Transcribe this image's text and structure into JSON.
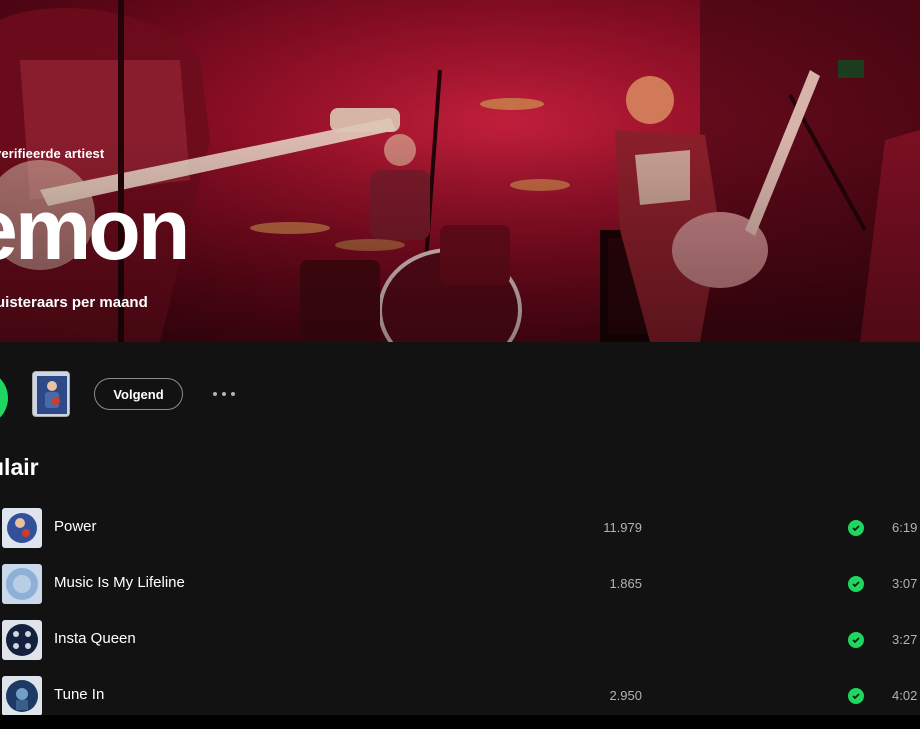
{
  "artist": {
    "verified_label": "verifieerde artiest",
    "name": "emon",
    "monthly_listeners": "uisteraars per maand"
  },
  "actions": {
    "follow_label": "Volgend",
    "more_icon": "more-horizontal-icon",
    "play_icon": "play-icon"
  },
  "popular": {
    "title": "ulair",
    "tracks": [
      {
        "title": "Power",
        "plays": "11.979",
        "duration": "6:19"
      },
      {
        "title": "Music Is My Lifeline",
        "plays": "1.865",
        "duration": "3:07"
      },
      {
        "title": "Insta Queen",
        "plays": "",
        "duration": "3:27"
      },
      {
        "title": "Tune In",
        "plays": "2.950",
        "duration": "4:02"
      }
    ]
  },
  "colors": {
    "accent": "#1ed760",
    "hero_red": "#8a0b22",
    "background": "#121212"
  }
}
